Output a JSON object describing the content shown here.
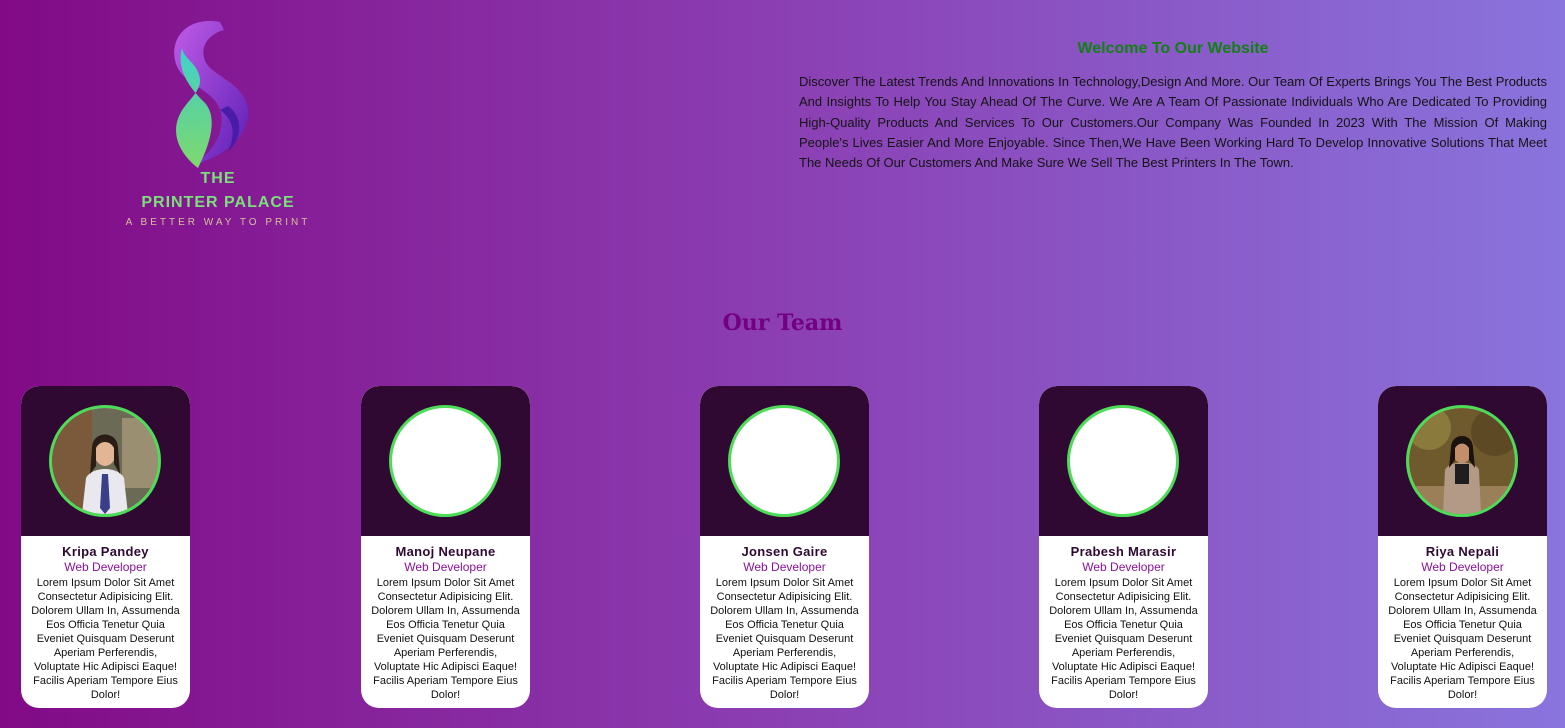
{
  "logo": {
    "line1": "THE",
    "line2": "PRINTER PALACE",
    "tagline": "A BETTER WAY TO PRINT",
    "icon": "ribbon-logo-icon",
    "colors": {
      "brand_green": "#7be07a",
      "brand_purple": "#7b2fd0"
    }
  },
  "welcome": {
    "title": "Welcome To Our Website",
    "text": "Discover The Latest Trends And Innovations In Technology,Design And More. Our Team Of Experts Brings You The Best Products And Insights To Help You Stay Ahead Of The Curve. We Are A Team Of Passionate Individuals Who Are Dedicated To Providing High-Quality Products And Services To Our Customers.Our Company Was Founded In 2023 With The Mission Of Making People's Lives Easier And More Enjoyable. Since Then,We Have Been Working Hard To Develop Innovative Solutions That Meet The Needs Of Our Customers And Make Sure We Sell The Best Printers In The Town."
  },
  "team": {
    "heading": "Our Team",
    "members": [
      {
        "name": "Kripa Pandey",
        "role": "Web Developer",
        "description": "Lorem Ipsum Dolor Sit Amet Consectetur Adipisicing Elit. Dolorem Ullam In, Assumenda Eos Officia Tenetur Quia Eveniet Quisquam Deserunt Aperiam Perferendis, Voluptate Hic Adipisci Eaque! Facilis Aperiam Tempore Eius Dolor!",
        "photo": "photo"
      },
      {
        "name": "Manoj Neupane",
        "role": "Web Developer",
        "description": "Lorem Ipsum Dolor Sit Amet Consectetur Adipisicing Elit. Dolorem Ullam In, Assumenda Eos Officia Tenetur Quia Eveniet Quisquam Deserunt Aperiam Perferendis, Voluptate Hic Adipisci Eaque! Facilis Aperiam Tempore Eius Dolor!",
        "photo": "blank"
      },
      {
        "name": "Jonsen Gaire",
        "role": "Web Developer",
        "description": "Lorem Ipsum Dolor Sit Amet Consectetur Adipisicing Elit. Dolorem Ullam In, Assumenda Eos Officia Tenetur Quia Eveniet Quisquam Deserunt Aperiam Perferendis, Voluptate Hic Adipisci Eaque! Facilis Aperiam Tempore Eius Dolor!",
        "photo": "blank"
      },
      {
        "name": "Prabesh Marasir",
        "role": "Web Developer",
        "description": "Lorem Ipsum Dolor Sit Amet Consectetur Adipisicing Elit. Dolorem Ullam In, Assumenda Eos Officia Tenetur Quia Eveniet Quisquam Deserunt Aperiam Perferendis, Voluptate Hic Adipisci Eaque! Facilis Aperiam Tempore Eius Dolor!",
        "photo": "blank"
      },
      {
        "name": "Riya Nepali",
        "role": "Web Developer",
        "description": "Lorem Ipsum Dolor Sit Amet Consectetur Adipisicing Elit. Dolorem Ullam In, Assumenda Eos Officia Tenetur Quia Eveniet Quisquam Deserunt Aperiam Perferendis, Voluptate Hic Adipisci Eaque! Facilis Aperiam Tempore Eius Dolor!",
        "photo": "photo"
      }
    ]
  },
  "colors": {
    "card_header": "#300933",
    "avatar_ring": "#4ddc57",
    "heading": "#730080",
    "welcome_title": "#128012"
  }
}
